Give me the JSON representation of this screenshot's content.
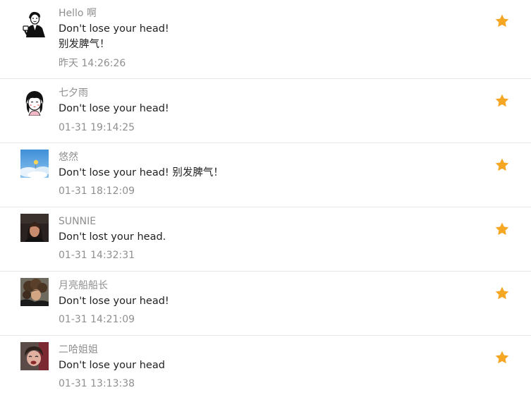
{
  "colors": {
    "star": "#F5A623",
    "name": "#8F8F8F",
    "text": "#222222",
    "divider": "#E6E6E6"
  },
  "comments": [
    {
      "user": "Hello 啊",
      "lines": [
        "Don't lose your head!",
        "别发脾气！"
      ],
      "time": "昨天 14:26:26",
      "avatar": "cartoon-man-avatar",
      "starred": true
    },
    {
      "user": "七夕雨",
      "lines": [
        "Don't lose your head!"
      ],
      "time": "01-31 19:14:25",
      "avatar": "cartoon-girl-avatar",
      "starred": true
    },
    {
      "user": " 悠然",
      "lines": [
        "Don't lose your head! 别发脾气！"
      ],
      "time": "01-31 18:12:09",
      "avatar": "sky-balloon-avatar",
      "starred": true
    },
    {
      "user": "SUNNIE",
      "lines": [
        "Don't lost your head."
      ],
      "time": "01-31 14:32:31",
      "avatar": "woman-photo-avatar",
      "starred": true
    },
    {
      "user": "月亮船船长",
      "lines": [
        "Don't lose your head!"
      ],
      "time": "01-31 14:21:09",
      "avatar": "curly-hair-photo-avatar",
      "starred": true
    },
    {
      "user": "二哈姐姐",
      "lines": [
        "Don't lose your head"
      ],
      "time": "01-31 13:13:38",
      "avatar": "child-photo-avatar",
      "starred": true
    }
  ]
}
